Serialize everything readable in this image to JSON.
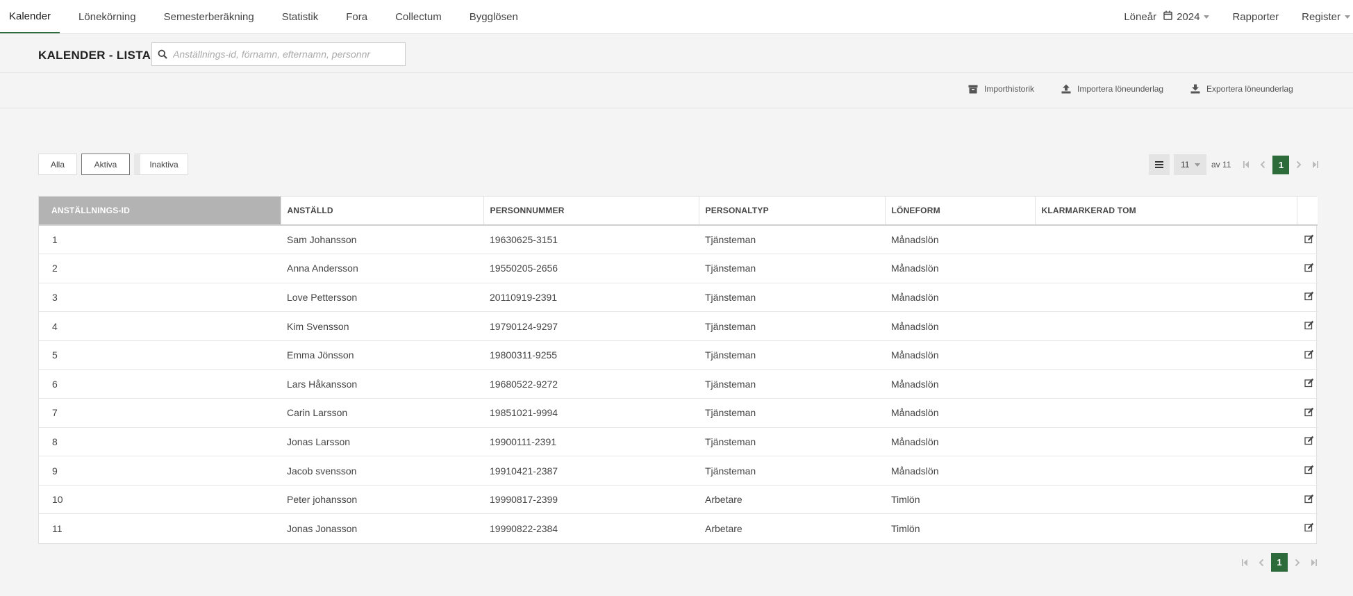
{
  "nav": {
    "tabs": [
      {
        "label": "Kalender",
        "active": true
      },
      {
        "label": "Lönekörning"
      },
      {
        "label": "Semesterberäkning"
      },
      {
        "label": "Statistik"
      },
      {
        "label": "Fora"
      },
      {
        "label": "Collectum"
      },
      {
        "label": "Bygglösen"
      }
    ],
    "loneår_label": "Löneår",
    "year": "2024",
    "rapporter": "Rapporter",
    "register": "Register"
  },
  "header": {
    "title": "KALENDER - LISTA",
    "search_placeholder": "Anställnings-id, förnamn, efternamn, personnr"
  },
  "actions": {
    "importhistorik": "Importhistorik",
    "importera": "Importera löneunderlag",
    "exportera": "Exportera löneunderlag"
  },
  "filters": {
    "alla": "Alla",
    "aktiva": "Aktiva",
    "inaktiva": "Inaktiva"
  },
  "pager": {
    "page_size": "11",
    "of_text": "av 11",
    "current_page": "1"
  },
  "table": {
    "headers": [
      "Anställnings-id",
      "Anställd",
      "Personnummer",
      "Personaltyp",
      "Löneform",
      "Klarmarkerad tom"
    ],
    "rows": [
      [
        "1",
        "Sam Johansson",
        "19630625-3151",
        "Tjänsteman",
        "Månadslön",
        ""
      ],
      [
        "2",
        "Anna Andersson",
        "19550205-2656",
        "Tjänsteman",
        "Månadslön",
        ""
      ],
      [
        "3",
        "Love Pettersson",
        "20110919-2391",
        "Tjänsteman",
        "Månadslön",
        ""
      ],
      [
        "4",
        "Kim Svensson",
        "19790124-9297",
        "Tjänsteman",
        "Månadslön",
        ""
      ],
      [
        "5",
        "Emma Jönsson",
        "19800311-9255",
        "Tjänsteman",
        "Månadslön",
        ""
      ],
      [
        "6",
        "Lars Håkansson",
        "19680522-9272",
        "Tjänsteman",
        "Månadslön",
        ""
      ],
      [
        "7",
        "Carin Larsson",
        "19851021-9994",
        "Tjänsteman",
        "Månadslön",
        ""
      ],
      [
        "8",
        "Jonas Larsson",
        "19900111-2391",
        "Tjänsteman",
        "Månadslön",
        ""
      ],
      [
        "9",
        "Jacob svensson",
        "19910421-2387",
        "Tjänsteman",
        "Månadslön",
        ""
      ],
      [
        "10",
        "Peter johansson",
        "19990817-2399",
        "Arbetare",
        "Timlön",
        ""
      ],
      [
        "11",
        "Jonas Jonasson",
        "19990822-2384",
        "Arbetare",
        "Timlön",
        ""
      ]
    ]
  },
  "colors": {
    "accent": "#2e6b3a",
    "sorted_header": "#b3b3b3"
  }
}
